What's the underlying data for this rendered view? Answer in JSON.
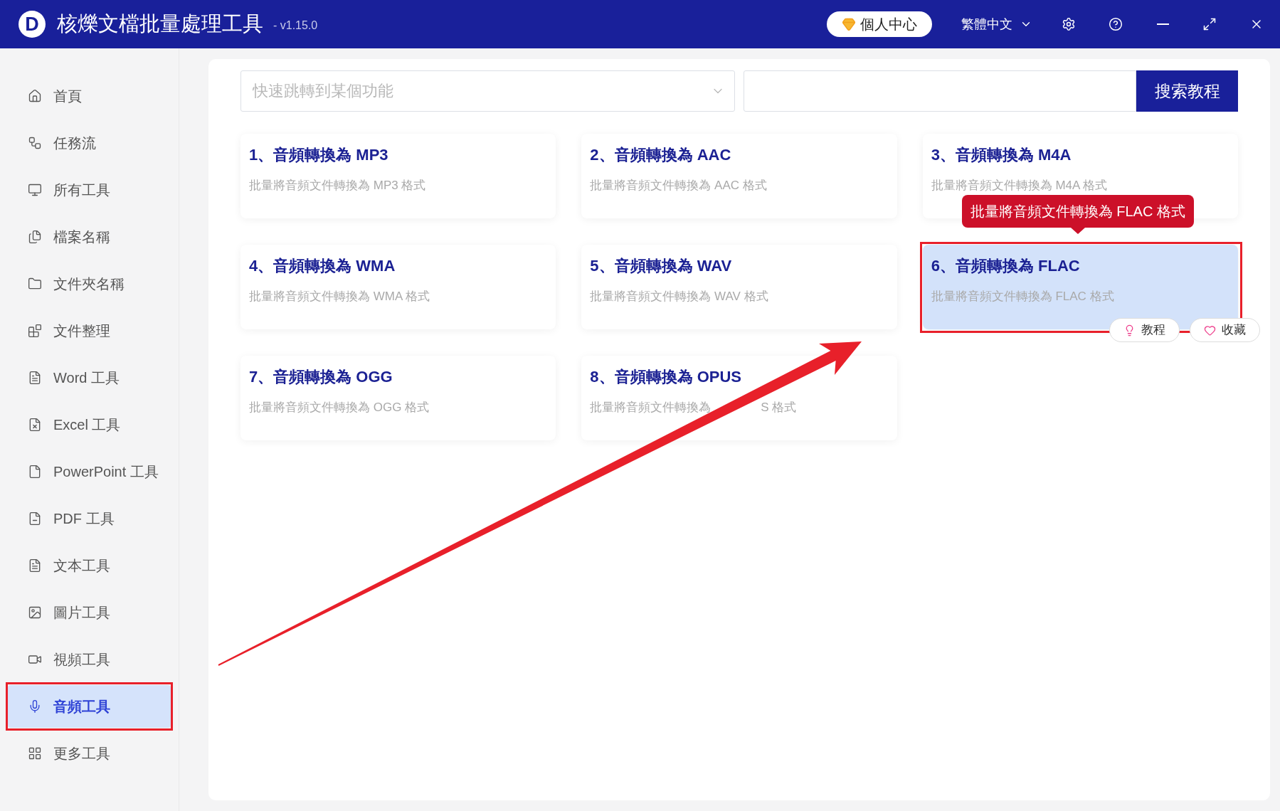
{
  "app": {
    "logo": "D",
    "title": "核爍文檔批量處理工具",
    "version": "- v1.15.0"
  },
  "user_center": "個人中心",
  "language": "繁體中文",
  "sidebar": {
    "items": [
      {
        "label": "首頁",
        "selected": false,
        "boxed": false
      },
      {
        "label": "任務流",
        "selected": false,
        "boxed": false
      },
      {
        "label": "所有工具",
        "selected": false,
        "boxed": false
      },
      {
        "label": "檔案名稱",
        "selected": false,
        "boxed": false
      },
      {
        "label": "文件夾名稱",
        "selected": false,
        "boxed": false
      },
      {
        "label": "文件整理",
        "selected": false,
        "boxed": false
      },
      {
        "label": "Word 工具",
        "selected": false,
        "boxed": false
      },
      {
        "label": "Excel 工具",
        "selected": false,
        "boxed": false
      },
      {
        "label": "PowerPoint 工具",
        "selected": false,
        "boxed": false
      },
      {
        "label": "PDF 工具",
        "selected": false,
        "boxed": false
      },
      {
        "label": "文本工具",
        "selected": false,
        "boxed": false
      },
      {
        "label": "圖片工具",
        "selected": false,
        "boxed": false
      },
      {
        "label": "視頻工具",
        "selected": false,
        "boxed": false
      },
      {
        "label": "音頻工具",
        "selected": true,
        "boxed": true
      },
      {
        "label": "更多工具",
        "selected": false,
        "boxed": false
      }
    ]
  },
  "function_select": {
    "placeholder": "快速跳轉到某個功能"
  },
  "search": {
    "button": "搜索教程"
  },
  "cards": [
    {
      "title": "1、音頻轉換為 MP3",
      "description": "批量將音頻文件轉換為 MP3 格式",
      "selected": false,
      "boxed": false
    },
    {
      "title": "2、音頻轉換為 AAC",
      "description": "批量將音頻文件轉換為 AAC 格式",
      "selected": false,
      "boxed": false
    },
    {
      "title": "3、音頻轉換為 M4A",
      "description": "批量將音頻文件轉換為 M4A 格式",
      "selected": false,
      "boxed": false
    },
    {
      "title": "4、音頻轉換為 WMA",
      "description": "批量將音頻文件轉換為 WMA 格式",
      "selected": false,
      "boxed": false
    },
    {
      "title": "5、音頻轉換為 WAV",
      "description": "批量將音頻文件轉換為 WAV 格式",
      "selected": false,
      "boxed": false
    },
    {
      "title": "6、音頻轉換為 FLAC",
      "description": "批量將音頻文件轉換為 FLAC 格式",
      "selected": true,
      "boxed": true,
      "tooltip": "批量將音頻文件轉換為 FLAC 格式",
      "actions": [
        "教程",
        "收藏"
      ]
    },
    {
      "title": "7、音頻轉換為 OGG",
      "description": "批量將音頻文件轉換為 OGG 格式",
      "selected": false,
      "boxed": false
    },
    {
      "title": "8、音頻轉換為 OPUS",
      "description": "批量將音頻文件轉換為",
      "description_tail": "S 格式",
      "selected": false,
      "boxed": false
    }
  ]
}
